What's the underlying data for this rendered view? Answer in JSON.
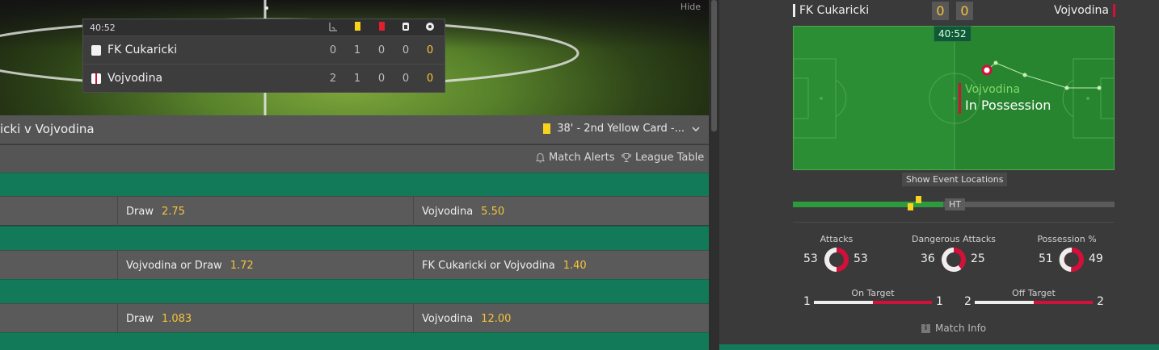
{
  "hero": {
    "hide_label": "Hide",
    "clock": "40:52",
    "stat_icons": [
      "corner-flag-icon",
      "yellow-card-icon",
      "red-card-icon",
      "substitution-icon",
      "goals-ball-icon"
    ],
    "teams": [
      {
        "name": "FK Cukaricki",
        "kit_color": "#ffffff",
        "stats": [
          "0",
          "1",
          "0",
          "0",
          "0"
        ]
      },
      {
        "name": "Vojvodina",
        "kit_color": "#d3103a",
        "stats": [
          "2",
          "1",
          "0",
          "0",
          "0"
        ]
      }
    ]
  },
  "match_bar": {
    "title": "icki v Vojvodina",
    "event": "38' - 2nd Yellow Card -..."
  },
  "links": {
    "match_alerts": "Match Alerts",
    "league_table": "League Table"
  },
  "markets": [
    {
      "col2_label": "Draw",
      "col2_odds": "2.75",
      "col3_label": "Vojvodina",
      "col3_odds": "5.50"
    },
    {
      "col2_label": "Vojvodina or Draw",
      "col2_odds": "1.72",
      "col3_label": "FK Cukaricki or Vojvodina",
      "col3_odds": "1.40"
    },
    {
      "col2_label": "Draw",
      "col2_odds": "1.083",
      "col3_label": "Vojvodina",
      "col3_odds": "12.00"
    }
  ],
  "tracker": {
    "home": "FK Cukaricki",
    "away": "Vojvodina",
    "home_score": "0",
    "away_score": "0",
    "clock": "40:52",
    "possession_team": "Vojvodina",
    "possession_label": "In Possession",
    "show_events": "Show Event Locations",
    "ht_label": "HT",
    "timeline_progress": 0.4681
  },
  "stats": {
    "attacks": {
      "label": "Attacks",
      "home": "53",
      "away": "53"
    },
    "dangerous": {
      "label": "Dangerous Attacks",
      "home": "36",
      "away": "25"
    },
    "possession": {
      "label": "Possession %",
      "home": "51",
      "away": "49"
    },
    "on_target": {
      "label": "On Target",
      "home": "1",
      "away": "1"
    },
    "off_target": {
      "label": "Off Target",
      "home": "2",
      "away": "2"
    }
  },
  "match_info": "Match Info",
  "colors": {
    "accent_yellow": "#f5c33b",
    "home": "#ffffff",
    "away": "#d3103a",
    "market_green": "#127a58"
  }
}
